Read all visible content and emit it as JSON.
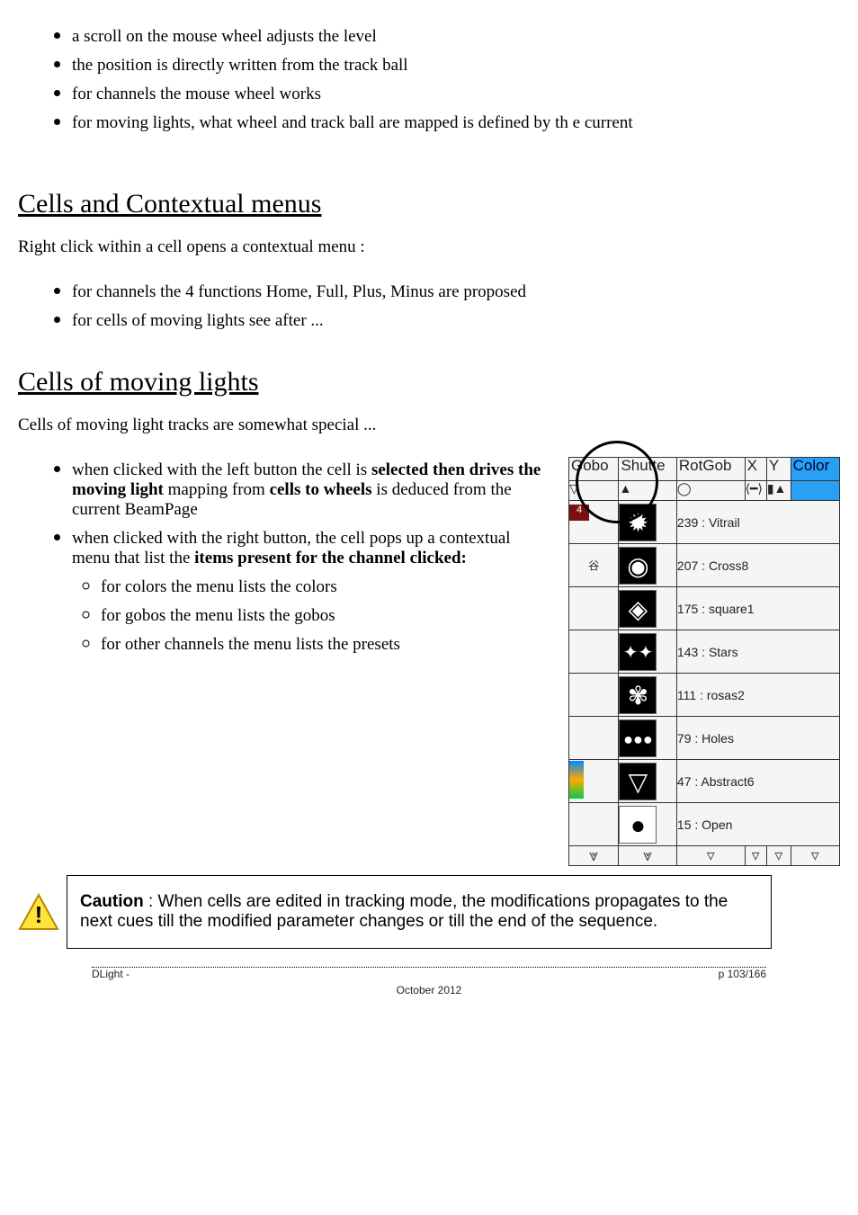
{
  "list1": {
    "i1": "a scroll on the mouse wheel adjusts the level",
    "i2": "the position is directly written from the track ball"
  },
  "list2": {
    "i1": "for channels the mouse wheel works",
    "i2": "for moving lights, what wheel and track ball are mapped is defined by th e current"
  },
  "heading1": "Cells and Contextual menus",
  "sub1": "Right click within a cell opens a contextual menu :",
  "list3": {
    "i1": "for channels the 4 functions Home, Full, Plus, Minus are proposed",
    "i2": "for cells of moving lights see after ..."
  },
  "heading2": "Cells of moving lights",
  "sub2": "Cells of moving light tracks are somewhat special ...",
  "list4": {
    "i1a": "when clicked with the left button the cell is ",
    "i1b": "selected then drives the moving light",
    "i1c": " mapping from ",
    "i1d": "cells to wheels",
    "i1e": " is deduced from the current BeamPage",
    "i2": "when clicked with the right button, the cell pops up a contextual menu that list the ",
    "i2b": "items present for the channel clicked:"
  },
  "list5": {
    "i1": "for colors the menu lists the colors",
    "i2": "for gobos the menu lists the gobos",
    "i3": "for other channels the menu lists the presets"
  },
  "caution": {
    "label": "Caution",
    "text": " : When cells are edited in tracking mode, the modifications propagates to the next cues till the modified parameter changes or till the end of the sequence."
  },
  "gobo_table": {
    "headers": [
      "Gobo",
      "Shutte",
      "RotGob",
      "X",
      "Y",
      "Color"
    ],
    "rows": [
      {
        "dmx": 239,
        "name": "Vitrail"
      },
      {
        "dmx": 207,
        "name": "Cross8"
      },
      {
        "dmx": 175,
        "name": "square1"
      },
      {
        "dmx": 143,
        "name": "Stars"
      },
      {
        "dmx": 111,
        "name": "rosas2"
      },
      {
        "dmx": 79,
        "name": "Holes"
      },
      {
        "dmx": 47,
        "name": "Abstract6"
      },
      {
        "dmx": 15,
        "name": "Open"
      }
    ]
  },
  "footer": {
    "left": "DLight - ",
    "center": "October 2012",
    "right": "p 103/166"
  }
}
